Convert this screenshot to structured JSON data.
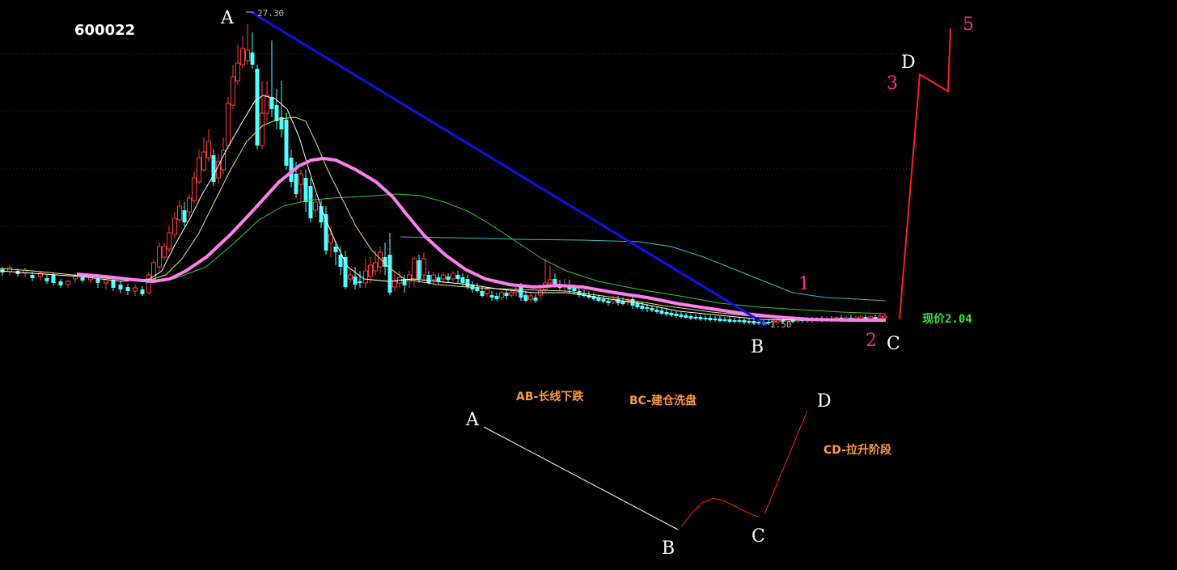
{
  "chart_data": {
    "type": "candlestick",
    "stock_code": "600022",
    "high_price_label": "27.30",
    "low_price_label": "1.50",
    "current_price_label": "现价2.04",
    "point_labels": {
      "A": "A",
      "B": "B",
      "C": "C",
      "D": "D"
    },
    "wave_labels": [
      "1",
      "2",
      "3",
      "5"
    ],
    "schematic": {
      "labels": {
        "A": "A",
        "B": "B",
        "C": "C",
        "D": "D"
      },
      "annotations": {
        "ab": "AB-长线下跌",
        "bc": "BC-建仓洗盘",
        "cd": "CD-拉升阶段"
      }
    },
    "colors": {
      "up": "#ff3c3c",
      "down": "#54ffff",
      "trend_line": "#0a14e6",
      "ma_thick": "#ff7ff0",
      "ma_green": "#33cc33",
      "ma_yellow": "#e5e566",
      "ma_white": "#ffffff",
      "ma_teal": "#3cbcc8",
      "wave_label": "#ff2a8a",
      "annotation": "#ff9a3c",
      "current_price": "#2ee82e"
    }
  }
}
